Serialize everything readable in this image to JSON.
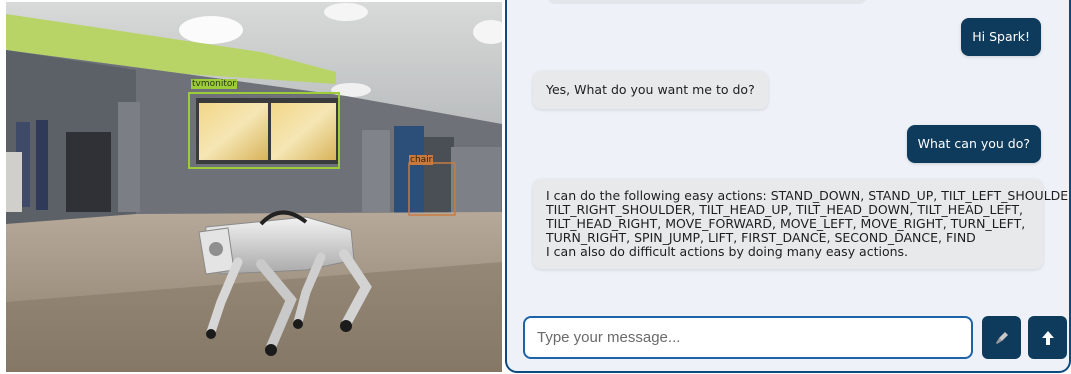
{
  "camera": {
    "detections": [
      {
        "label": "tvmonitor",
        "color": "#9ccc3a"
      },
      {
        "label": "chair",
        "color": "#c87a3e"
      }
    ]
  },
  "chat": {
    "messages": [
      {
        "role": "user",
        "text": "Hi Spark!"
      },
      {
        "role": "bot",
        "text": "Yes, What do you want me to do?"
      },
      {
        "role": "user",
        "text": "What can you do?"
      },
      {
        "role": "bot",
        "lines": [
          "I can do the following easy actions: STAND_DOWN, STAND_UP, TILT_LEFT_SHOULDER,",
          "TILT_RIGHT_SHOULDER, TILT_HEAD_UP, TILT_HEAD_DOWN, TILT_HEAD_LEFT,",
          "TILT_HEAD_RIGHT, MOVE_FORWARD, MOVE_LEFT, MOVE_RIGHT, TURN_LEFT,",
          "TURN_RIGHT, SPIN_JUMP, LIFT, FIRST_DANCE, SECOND_DANCE, FIND",
          "I can also do difficult actions by doing many easy actions."
        ]
      }
    ],
    "composer": {
      "placeholder": "Type your message...",
      "value": ""
    },
    "buttons": {
      "mic_icon": "microphone-icon",
      "send_icon": "arrow-up-icon"
    },
    "colors": {
      "accent": "#0e3a5c",
      "border": "#0d4a80",
      "bot_bubble": "#e8e9ea"
    }
  }
}
